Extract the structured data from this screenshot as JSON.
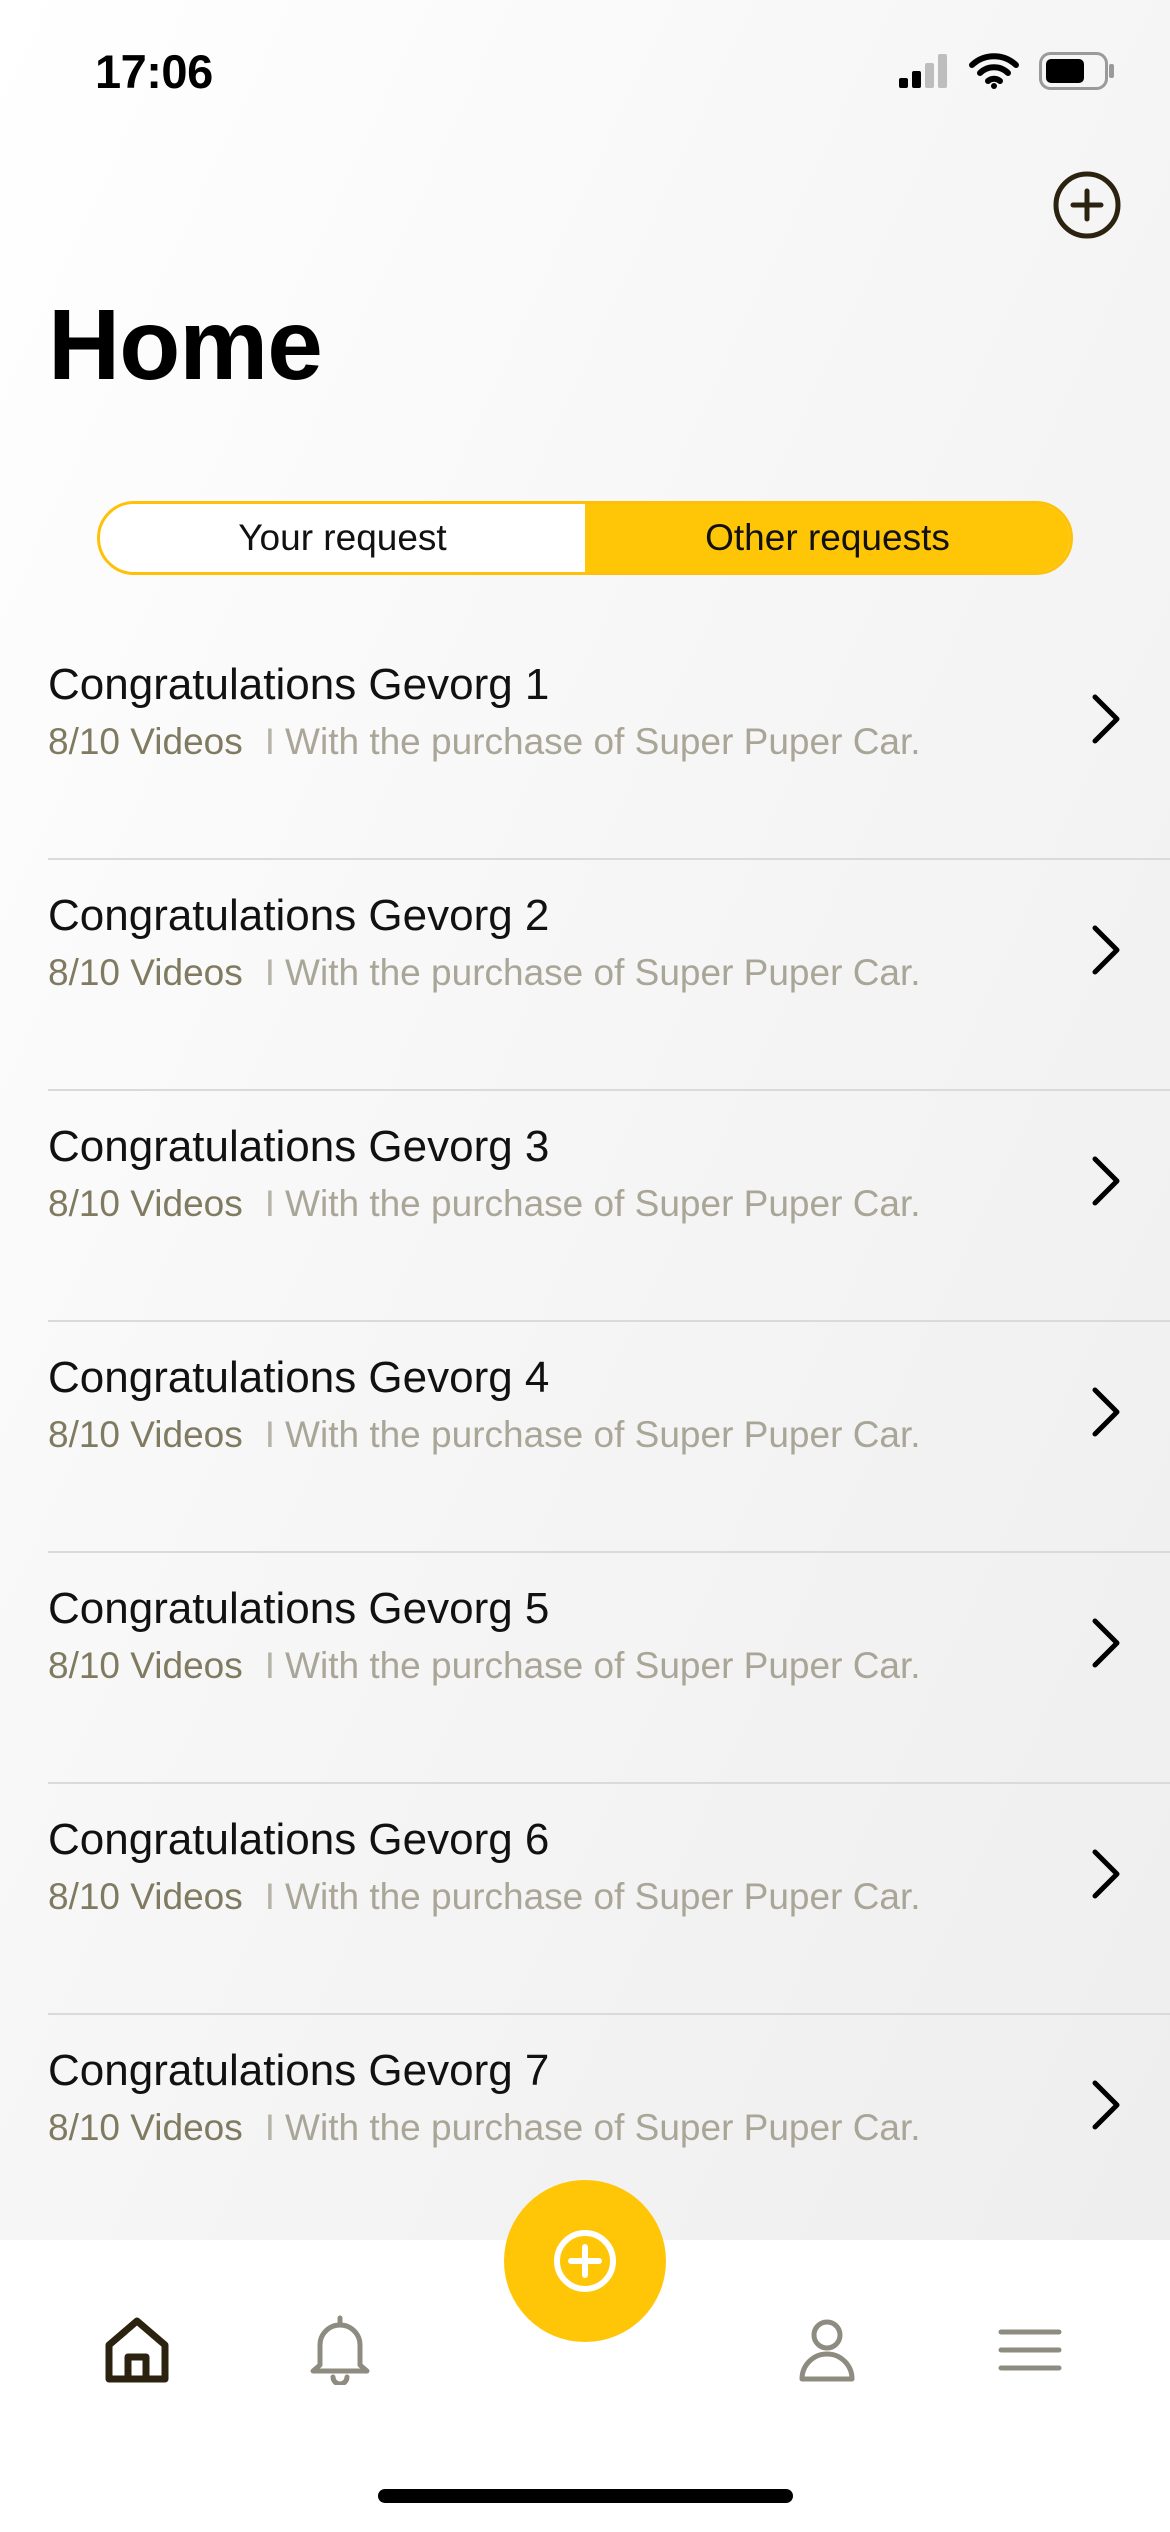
{
  "status_bar": {
    "time": "17:06",
    "signal_icon": "cellular-signal-icon",
    "wifi_icon": "wifi-icon",
    "battery_icon": "battery-icon"
  },
  "header": {
    "title": "Home",
    "add_icon": "plus-circle-icon"
  },
  "segmented": {
    "tabs": [
      "Your request",
      "Other requests"
    ],
    "selected": "Other requests"
  },
  "requests": [
    {
      "title": "Congratulations Gevorg 1",
      "count": "8/10 Videos",
      "separator": "I",
      "description": "With the purchase of Super Puper Car."
    },
    {
      "title": "Congratulations Gevorg 2",
      "count": "8/10 Videos",
      "separator": "I",
      "description": "With the purchase of Super Puper Car."
    },
    {
      "title": "Congratulations Gevorg 3",
      "count": "8/10 Videos",
      "separator": "I",
      "description": "With the purchase of Super Puper Car."
    },
    {
      "title": "Congratulations Gevorg 4",
      "count": "8/10 Videos",
      "separator": "I",
      "description": "With the purchase of Super Puper Car."
    },
    {
      "title": "Congratulations Gevorg 5",
      "count": "8/10 Videos",
      "separator": "I",
      "description": "With the purchase of Super Puper Car."
    },
    {
      "title": "Congratulations Gevorg 6",
      "count": "8/10 Videos",
      "separator": "I",
      "description": "With the purchase of Super Puper Car."
    },
    {
      "title": "Congratulations Gevorg 7",
      "count": "8/10 Videos",
      "separator": "I",
      "description": "With the purchase of Super Puper Car."
    }
  ],
  "tab_bar": {
    "items": [
      "home-icon",
      "bell-icon",
      "profile-icon",
      "menu-icon"
    ],
    "active": "home-icon",
    "fab_icon": "plus-circle-icon"
  },
  "colors": {
    "accent": "#FFC507",
    "dark": "#2b230f",
    "inactive": "#8e8b80",
    "muted": "#a9a698"
  }
}
